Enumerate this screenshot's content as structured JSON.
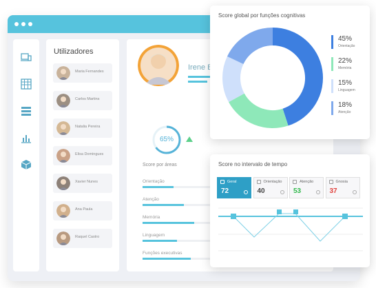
{
  "sidebar_icons": [
    "devices-icon",
    "calendar-grid-icon",
    "list-icon",
    "bar-chart-icon",
    "box-icon"
  ],
  "users": {
    "title": "Utilizadores",
    "items": [
      {
        "name": "Maria Fernandes"
      },
      {
        "name": "Carlos Martins"
      },
      {
        "name": "Natalia Pereira"
      },
      {
        "name": "Elisa Domingues"
      },
      {
        "name": "Xavier Nunes"
      },
      {
        "name": "Ana Paula"
      },
      {
        "name": "Raquel Castro"
      }
    ]
  },
  "profile": {
    "name": "Irene B",
    "score_pct": "65%",
    "score_value": 0.65,
    "areas_title": "Score por áreas",
    "areas": [
      {
        "label": "Orientação",
        "value": 0.45
      },
      {
        "label": "Atenção",
        "value": 0.6
      },
      {
        "label": "Memória",
        "value": 0.75
      },
      {
        "label": "Linguagem",
        "value": 0.5
      },
      {
        "label": "Funções executivas",
        "value": 0.7
      }
    ]
  },
  "donut": {
    "title": "Score global por funções cognitivas",
    "segments": [
      {
        "pct": "45%",
        "label": "Orientação",
        "value": 45,
        "color": "#3d7fe0"
      },
      {
        "pct": "22%",
        "label": "Memória",
        "value": 22,
        "color": "#8ee8b9"
      },
      {
        "pct": "15%",
        "label": "Linguagem",
        "value": 15,
        "color": "#cfe0fb"
      },
      {
        "pct": "18%",
        "label": "Atenção",
        "value": 18,
        "color": "#7fa9ec"
      }
    ]
  },
  "timeline": {
    "title": "Score no intervalo de tempo",
    "tiles": [
      {
        "label": "Geral",
        "value": "72",
        "color": "#ffffff",
        "active": true
      },
      {
        "label": "Orientação",
        "value": "40",
        "color": "#444444",
        "active": false
      },
      {
        "label": "Atenção",
        "value": "53",
        "color": "#2fb84a",
        "active": false
      },
      {
        "label": "Gnosia",
        "value": "37",
        "color": "#e0403a",
        "active": false
      }
    ]
  },
  "colors": {
    "accent": "#56c3dd",
    "active_tile": "#2e9fc6"
  }
}
